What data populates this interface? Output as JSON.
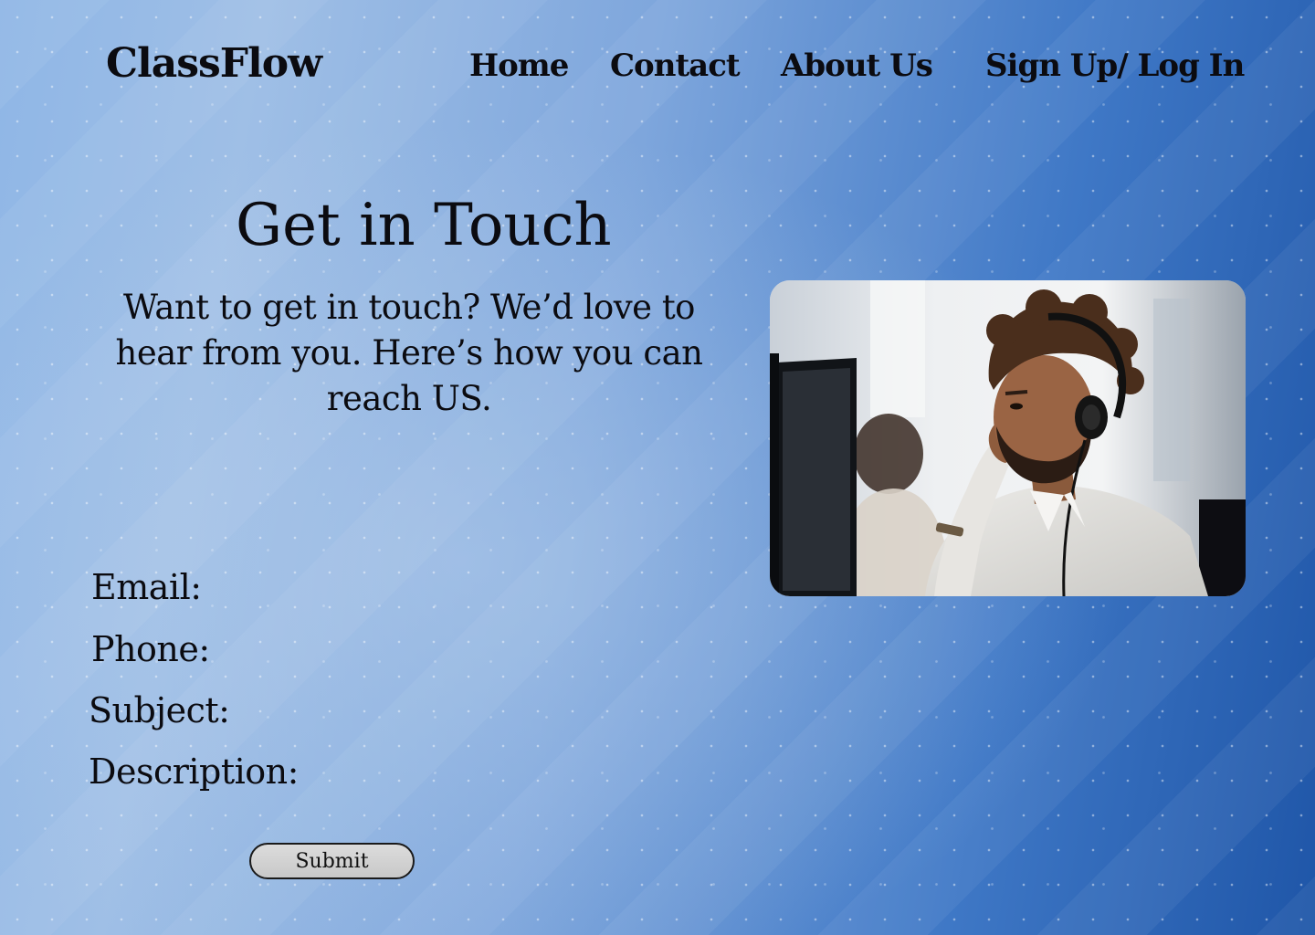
{
  "brand": {
    "name": "ClassFlow"
  },
  "nav": {
    "home": "Home",
    "contact": "Contact",
    "about": "About Us",
    "auth": "Sign Up/ Log In"
  },
  "main": {
    "title": "Get in Touch",
    "intro": "Want to get in touch? We’d love to hear from you. Here’s how you can reach US.",
    "image": {
      "subject": "man-with-headset-at-computer"
    }
  },
  "form": {
    "email_label": "Email:",
    "phone_label": "Phone:",
    "subject_label": "Subject:",
    "description_label": "Description:",
    "submit_label": "Submit"
  },
  "colors": {
    "background_light": "#9fbfe6",
    "background_dark": "#1f56a8",
    "text": "#0b0b10",
    "button": "#d0d0d0"
  }
}
